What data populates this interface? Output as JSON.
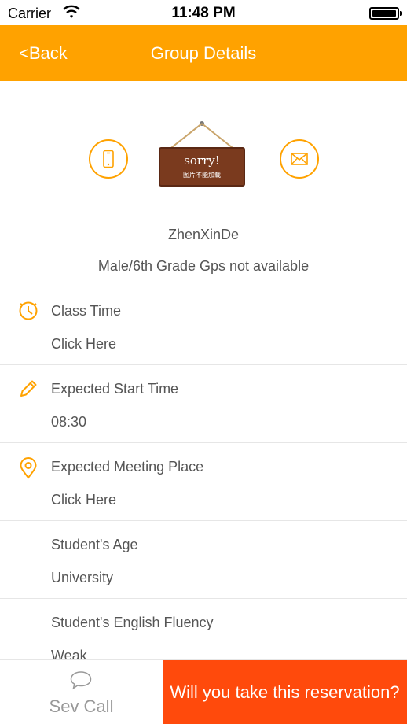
{
  "status_bar": {
    "carrier": "Carrier",
    "time": "11:48 PM"
  },
  "nav": {
    "back_label": "<Back",
    "title": "Group Details"
  },
  "profile": {
    "avatar_placeholder_title": "sorry!",
    "avatar_placeholder_sub": "图片不能加载",
    "name": "ZhenXinDe",
    "meta": "Male/6th Grade Gps not available"
  },
  "sections": [
    {
      "label": "Class Time",
      "value": "Click Here",
      "icon": "clock-icon"
    },
    {
      "label": "Expected Start Time",
      "value": "08:30",
      "icon": "pencil-icon"
    },
    {
      "label": "Expected Meeting Place",
      "value": "Click Here",
      "icon": "location-pin-icon"
    },
    {
      "label": "Student's Age",
      "value": "University"
    },
    {
      "label": "Student's English Fluency",
      "value": "Weak"
    }
  ],
  "bottom": {
    "sev_call_label": "Sev Call",
    "reserve_label": "Will you take this reservation?"
  },
  "colors": {
    "accent": "#ffa200",
    "reserve": "#ff4a0c",
    "text": "#555555"
  }
}
